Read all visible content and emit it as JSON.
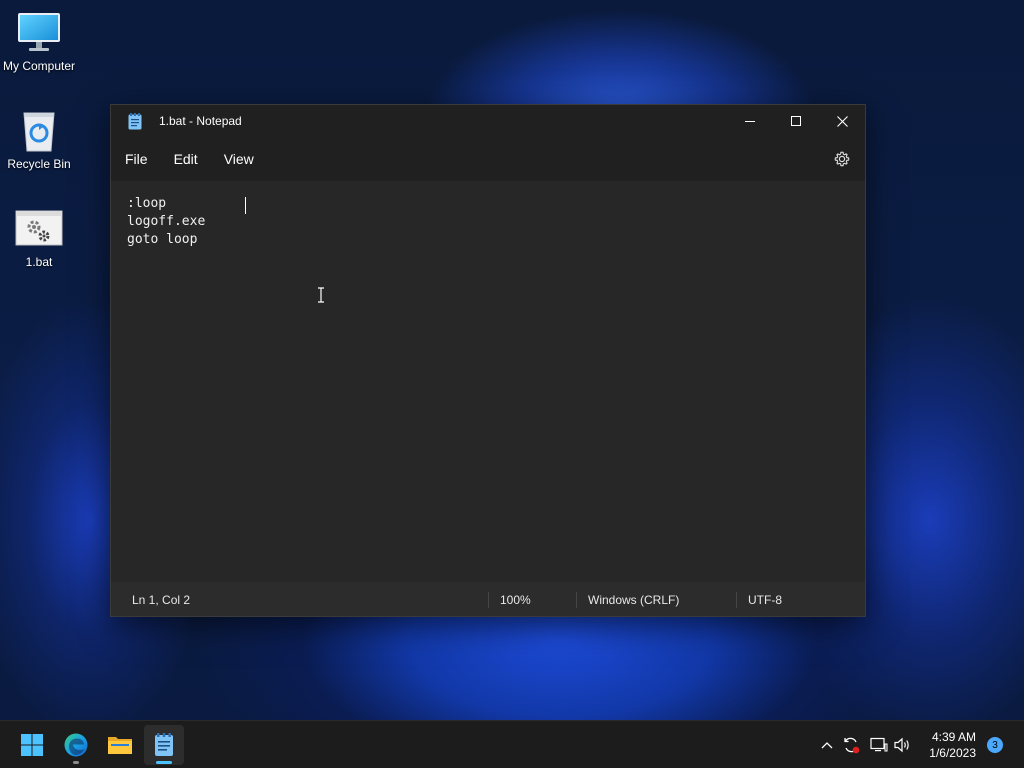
{
  "desktop": {
    "icons": [
      {
        "label": "My Computer",
        "icon": "monitor-icon"
      },
      {
        "label": "Recycle Bin",
        "icon": "recycle-bin-icon"
      },
      {
        "label": "1.bat",
        "icon": "batch-file-icon"
      }
    ]
  },
  "window": {
    "title": "1.bat - Notepad",
    "app_icon": "notepad-icon",
    "menu": [
      "File",
      "Edit",
      "View"
    ],
    "settings_icon": "gear-icon",
    "editor_lines": [
      ":loop",
      "logoff.exe",
      "goto loop"
    ],
    "status": {
      "position": "Ln 1, Col 2",
      "zoom": "100%",
      "line_ending": "Windows (CRLF)",
      "encoding": "UTF-8"
    }
  },
  "taskbar": {
    "pinned": [
      "start-icon",
      "edge-icon",
      "file-explorer-icon",
      "notepad-icon"
    ],
    "tray": [
      "chevron-up-icon",
      "sync-icon",
      "network-icon",
      "volume-icon"
    ],
    "time": "4:39 AM",
    "date": "1/6/2023",
    "notification_count": "3"
  },
  "colors": {
    "accent": "#4aa8ff",
    "window_bg": "#272727",
    "titlebar_bg": "#202020"
  }
}
